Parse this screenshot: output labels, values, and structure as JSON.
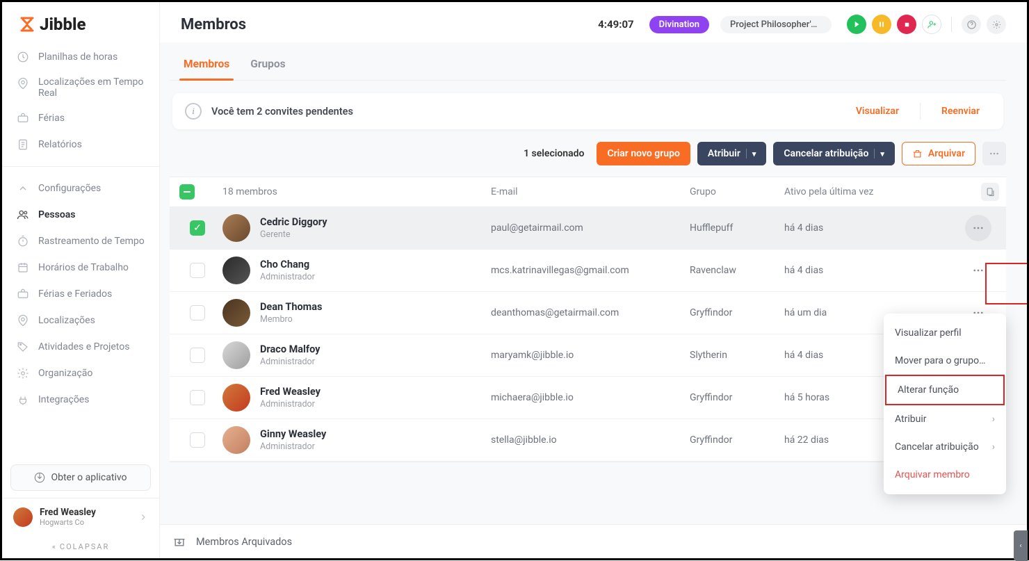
{
  "brand": "Jibble",
  "header": {
    "title": "Membros",
    "timer": "4:49:07",
    "activity": "Divination",
    "project": "Project Philosopher's S…"
  },
  "sidebar": {
    "items": [
      {
        "label": "Planilhas de horas"
      },
      {
        "label": "Localizações em Tempo Real"
      },
      {
        "label": "Férias"
      },
      {
        "label": "Relatórios"
      },
      {
        "label": "Configurações"
      },
      {
        "label": "Pessoas"
      },
      {
        "label": "Rastreamento de Tempo"
      },
      {
        "label": "Horários de Trabalho"
      },
      {
        "label": "Férias e Feriados"
      },
      {
        "label": "Localizações"
      },
      {
        "label": "Atividades e Projetos"
      },
      {
        "label": "Organização"
      },
      {
        "label": "Integrações"
      }
    ],
    "get_app": "Obter o aplicativo",
    "user": {
      "name": "Fred Weasley",
      "org": "Hogwarts Co"
    },
    "collapse": "COLAPSAR"
  },
  "tabs": {
    "members": "Membros",
    "groups": "Grupos"
  },
  "banner": {
    "msg": "Você tem 2 convites pendentes",
    "view": "Visualizar",
    "resend": "Reenviar"
  },
  "action_bar": {
    "selected": "1 selecionado",
    "create_group": "Criar novo grupo",
    "assign": "Atribuir",
    "unassign": "Cancelar atribuição",
    "archive": "Arquivar"
  },
  "table": {
    "count": "18 membros",
    "cols": {
      "email": "E-mail",
      "group": "Grupo",
      "last_active": "Ativo pela última vez"
    },
    "rows": [
      {
        "name": "Cedric Diggory",
        "role": "Gerente",
        "email": "paul@getairmail.com",
        "group": "Hufflepuff",
        "last": "há 4 dias",
        "selected": true,
        "av": "av1"
      },
      {
        "name": "Cho Chang",
        "role": "Administrador",
        "email": "mcs.katrinavillegas@gmail.com",
        "group": "Ravenclaw",
        "last": "há 4 dias",
        "av": "av2"
      },
      {
        "name": "Dean Thomas",
        "role": "Membro",
        "email": "deanthomas@getairmail.com",
        "group": "Gryffindor",
        "last": "há um dia",
        "av": "av3"
      },
      {
        "name": "Draco Malfoy",
        "role": "Administrador",
        "email": "maryamk@jibble.io",
        "group": "Slytherin",
        "last": "há 4 dias",
        "av": "av4"
      },
      {
        "name": "Fred Weasley",
        "role": "Administrador",
        "email": "michaera@jibble.io",
        "group": "Gryffindor",
        "last": "há 5 horas",
        "av": "av5"
      },
      {
        "name": "Ginny Weasley",
        "role": "Administrador",
        "email": "stella@jibble.io",
        "group": "Gryffindor",
        "last": "há 22 dias",
        "av": "av6"
      }
    ],
    "archived": "Membros Arquivados"
  },
  "context_menu": {
    "view": "Visualizar perfil",
    "move": "Mover para o grupo…",
    "change": "Alterar função",
    "assign": "Atribuir",
    "unassign": "Cancelar atribuição",
    "archive": "Arquivar membro"
  }
}
